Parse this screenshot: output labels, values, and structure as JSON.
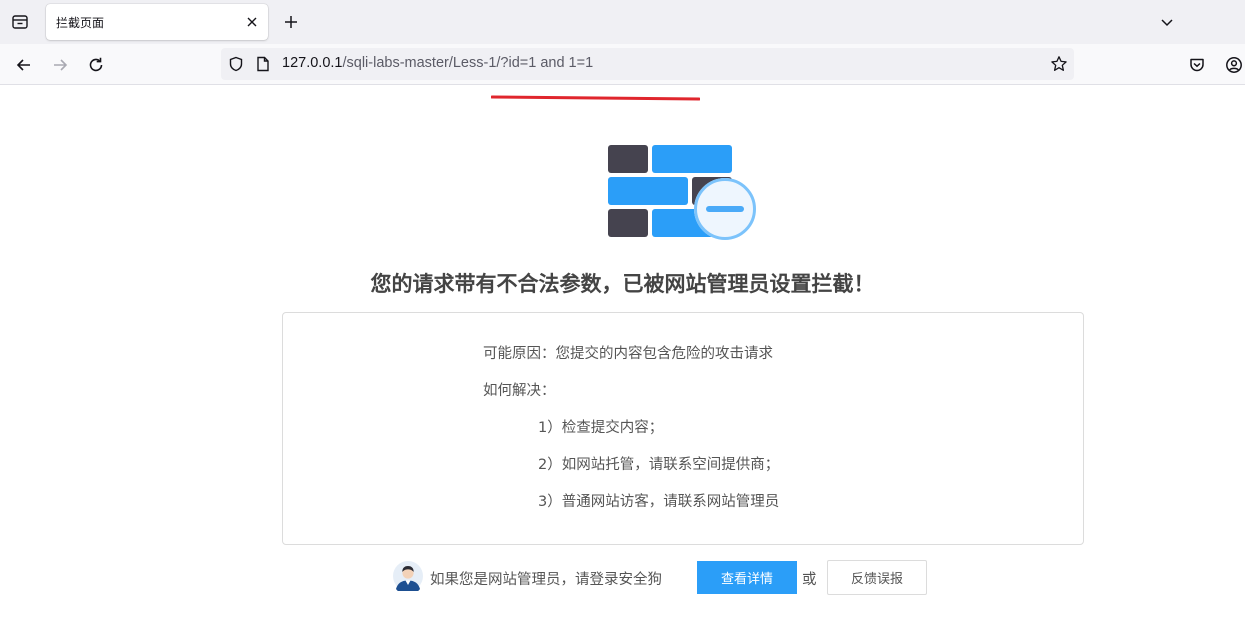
{
  "browser": {
    "tab": {
      "title": "拦截页面"
    },
    "url": {
      "host": "127.0.0.1",
      "path": "/sqli-labs-master/Less-1/?id=1 and 1=1"
    },
    "icons": {
      "tab_list": "tab-list-icon",
      "close_tab": "close-icon",
      "new_tab": "plus-icon",
      "tab_overflow": "chevron-down-icon",
      "back": "arrow-left-icon",
      "forward": "arrow-right-icon",
      "reload": "reload-icon",
      "tracking_protection": "shield-icon",
      "page_info": "page-icon",
      "bookmark": "star-icon",
      "pocket": "pocket-icon",
      "account": "account-icon"
    }
  },
  "page": {
    "heading": "您的请求带有不合法参数，已被网站管理员设置拦截！",
    "reason": {
      "possible_cause": "可能原因：您提交的内容包含危险的攻击请求",
      "how_to_solve": "如何解决：",
      "steps": [
        "1）检查提交内容；",
        "2）如网站托管，请联系空间提供商；",
        "3）普通网站访客，请联系网站管理员"
      ]
    },
    "footer": {
      "admin_hint": "如果您是网站管理员，请登录安全狗",
      "details_button": "查看详情",
      "or_text": "或",
      "feedback_button": "反馈误报"
    }
  },
  "colors": {
    "accent_blue": "#2b9ef8",
    "brick_dark": "#45434f",
    "brick_blue": "#2b9ef8",
    "annotation_red": "#e0262d"
  }
}
